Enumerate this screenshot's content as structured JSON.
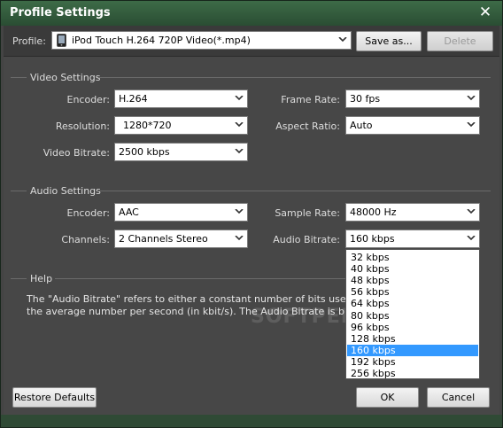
{
  "window": {
    "title": "Profile Settings"
  },
  "toolbar": {
    "profile_label": "Profile:",
    "profile_value": "iPod Touch H.264 720P Video(*.mp4)",
    "save_as_label": "Save as...",
    "delete_label": "Delete"
  },
  "video": {
    "group_title": "Video Settings",
    "encoder_label": "Encoder:",
    "encoder_value": "H.264",
    "frame_rate_label": "Frame Rate:",
    "frame_rate_value": "30 fps",
    "resolution_label": "Resolution:",
    "resolution_value": "1280*720",
    "aspect_ratio_label": "Aspect Ratio:",
    "aspect_ratio_value": "Auto",
    "bitrate_label": "Video Bitrate:",
    "bitrate_value": "2500 kbps"
  },
  "audio": {
    "group_title": "Audio Settings",
    "encoder_label": "Encoder:",
    "encoder_value": "AAC",
    "sample_rate_label": "Sample Rate:",
    "sample_rate_value": "48000 Hz",
    "channels_label": "Channels:",
    "channels_value": "2 Channels Stereo",
    "bitrate_label": "Audio Bitrate:",
    "bitrate_value": "160 kbps",
    "bitrate_options": [
      "32 kbps",
      "40 kbps",
      "48 kbps",
      "56 kbps",
      "64 kbps",
      "80 kbps",
      "96 kbps",
      "128 kbps",
      "160 kbps",
      "192 kbps",
      "256 kbps"
    ],
    "bitrate_selected_index": 8
  },
  "help": {
    "group_title": "Help",
    "line1": "The \"Audio Bitrate\" refers to either a constant number of bits used to Enco",
    "line2": "the average number per second (in kbit/s). The Audio Bitrate is bigger, the"
  },
  "footer": {
    "restore_label": "Restore Defaults",
    "ok_label": "OK",
    "cancel_label": "Cancel"
  },
  "watermark": "SOFTPEDIA",
  "colors": {
    "title_bar": "#2f5538",
    "panel": "#474747",
    "selection": "#3399ff"
  }
}
